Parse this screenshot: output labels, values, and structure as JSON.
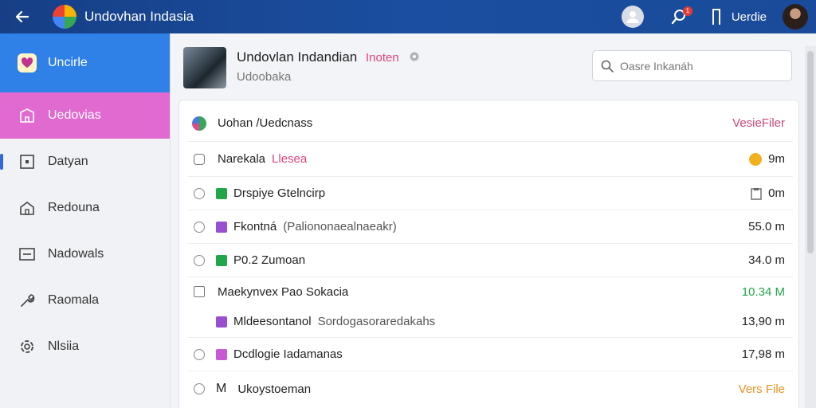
{
  "app": {
    "title": "Undovhan Indasia",
    "user_name": "Uerdie",
    "notification_count": "1"
  },
  "sidebar": {
    "items": [
      {
        "label": "Uncirle",
        "icon": "heart-icon"
      },
      {
        "label": "Uedovias",
        "icon": "building-icon"
      },
      {
        "label": "Datyan",
        "icon": "square-icon"
      },
      {
        "label": "Redouna",
        "icon": "house-icon"
      },
      {
        "label": "Nadowals",
        "icon": "card-icon"
      },
      {
        "label": "Raomala",
        "icon": "wrench-icon"
      },
      {
        "label": "Nlsiia",
        "icon": "settings-icon"
      }
    ]
  },
  "header": {
    "title": "Undovlan Indandian",
    "tag": "Inoten",
    "subtitle": "Udoobaka"
  },
  "search": {
    "placeholder": "Oasre Inkanáh"
  },
  "rows": [
    {
      "label": "Uohan /Uedcnass",
      "right": "VesieFiler"
    },
    {
      "label": "Narekala",
      "extra": "Llesea",
      "right": "9m"
    },
    {
      "label": "Drspiye Gtelncirp",
      "right": "0m"
    },
    {
      "label": "Fkontná",
      "extra": "(Paliononaealnaeakr)",
      "right": "55.0 m"
    },
    {
      "label": "P0.2 Zumoan",
      "right": "34.0 m"
    },
    {
      "label": "Maekynvex Pao Sokacia",
      "right": "10.34 M"
    },
    {
      "label": "Mldeesontanol",
      "extra": "Sordogasoraredakahs",
      "right": "13,90 m"
    },
    {
      "label": "Dcdlogie Iadamanas",
      "right": "17,98 m"
    },
    {
      "label": "Ukoystoeman",
      "lead": "M",
      "right": "Vers File"
    }
  ],
  "colors": {
    "accent": "#2f80e7",
    "pink": "#e06ad0",
    "green": "#21a64a",
    "orange": "#e8901f",
    "tag": "#d9467f"
  }
}
